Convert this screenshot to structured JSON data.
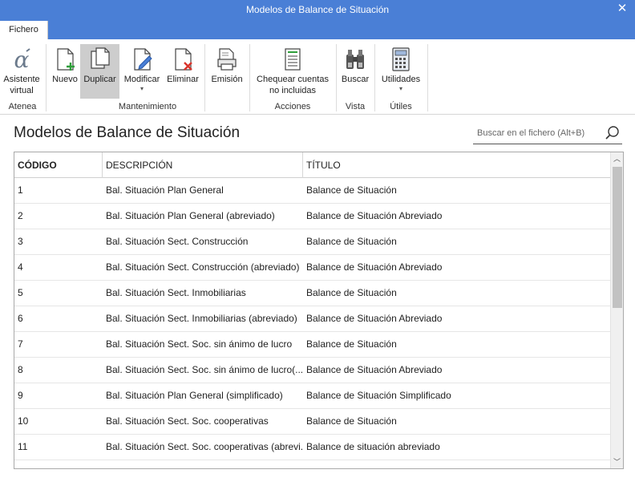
{
  "window": {
    "title": "Modelos de Balance de Situación",
    "close_glyph": "✕"
  },
  "tabs": [
    {
      "label": "Fichero"
    }
  ],
  "ribbon": {
    "groups": [
      {
        "label": "Atenea"
      },
      {
        "label": "Mantenimiento"
      },
      {
        "label": "Acciones"
      },
      {
        "label": "Vista"
      },
      {
        "label": "Útiles"
      }
    ],
    "buttons": {
      "asistente": {
        "line1": "Asistente",
        "line2": "virtual",
        "icon": "alpha-icon"
      },
      "nuevo": {
        "label": "Nuevo",
        "icon": "new-document-icon"
      },
      "duplicar": {
        "label": "Duplicar",
        "icon": "duplicate-icon"
      },
      "modificar": {
        "label": "Modificar",
        "icon": "edit-document-icon",
        "arrow": "▾"
      },
      "eliminar": {
        "label": "Eliminar",
        "icon": "delete-document-icon"
      },
      "emision": {
        "label": "Emisión",
        "icon": "printer-icon"
      },
      "chequear": {
        "line1": "Chequear cuentas",
        "line2": "no incluidas",
        "icon": "checklist-icon"
      },
      "buscar": {
        "label": "Buscar",
        "icon": "binoculars-icon"
      },
      "utilidades": {
        "label": "Utilidades",
        "icon": "calculator-icon",
        "arrow": "▾"
      }
    }
  },
  "page": {
    "title": "Modelos de Balance de Situación"
  },
  "search": {
    "placeholder": "Buscar en el fichero (Alt+B)",
    "icon": "search-icon"
  },
  "table": {
    "columns": [
      "CÓDIGO",
      "DESCRIPCIÓN",
      "TÍTULO"
    ],
    "rows": [
      {
        "codigo": "1",
        "descripcion": "Bal. Situación Plan General",
        "titulo": "Balance de Situación"
      },
      {
        "codigo": "2",
        "descripcion": "Bal. Situación Plan General (abreviado)",
        "titulo": "Balance de Situación Abreviado"
      },
      {
        "codigo": "3",
        "descripcion": "Bal. Situación Sect. Construcción",
        "titulo": "Balance de Situación"
      },
      {
        "codigo": "4",
        "descripcion": "Bal. Situación Sect. Construcción (abreviado)",
        "titulo": "Balance de Situación Abreviado"
      },
      {
        "codigo": "5",
        "descripcion": "Bal. Situación Sect. Inmobiliarias",
        "titulo": "Balance de Situación"
      },
      {
        "codigo": "6",
        "descripcion": "Bal. Situación Sect. Inmobiliarias (abreviado)",
        "titulo": "Balance de Situación Abreviado"
      },
      {
        "codigo": "7",
        "descripcion": "Bal. Situación Sect. Soc. sin ánimo de lucro",
        "titulo": "Balance de Situación"
      },
      {
        "codigo": "8",
        "descripcion": "Bal. Situación Sect. Soc. sin ánimo de lucro(...",
        "titulo": "Balance de Situación Abreviado"
      },
      {
        "codigo": "9",
        "descripcion": "Bal. Situación Plan General (simplificado)",
        "titulo": "Balance de Situación Simplificado"
      },
      {
        "codigo": "10",
        "descripcion": "Bal. Situación Sect. Soc. cooperativas",
        "titulo": "Balance de Situación"
      },
      {
        "codigo": "11",
        "descripcion": "Bal. Situación Sect. Soc. cooperativas (abrevi...",
        "titulo": "Balance de situación abreviado"
      }
    ]
  },
  "colors": {
    "accent": "#4a7fd6",
    "selected_button": "#cdcdcd",
    "green": "#2e9e3a",
    "red": "#d9332b"
  }
}
